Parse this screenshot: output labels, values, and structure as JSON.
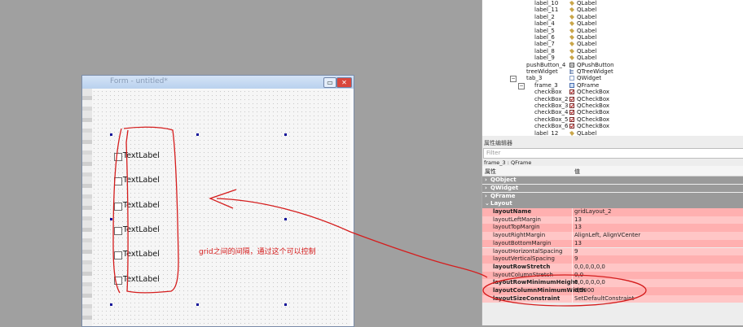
{
  "canvas": {
    "window_title": "Form - untitled*",
    "checkbox_labels": [
      "TextLabel",
      "TextLabel",
      "TextLabel",
      "TextLabel",
      "TextLabel",
      "TextLabel"
    ],
    "annotation": "grid之间的间隔，通过这个可以控制",
    "annotation_color": "#d51d1d"
  },
  "object_inspector": {
    "rows": [
      {
        "name": "label_10",
        "cls": "QLabel",
        "icon": "label-icon"
      },
      {
        "name": "label_11",
        "cls": "QLabel",
        "icon": "label-icon"
      },
      {
        "name": "label_2",
        "cls": "QLabel",
        "icon": "label-icon"
      },
      {
        "name": "label_4",
        "cls": "QLabel",
        "icon": "label-icon"
      },
      {
        "name": "label_5",
        "cls": "QLabel",
        "icon": "label-icon"
      },
      {
        "name": "label_6",
        "cls": "QLabel",
        "icon": "label-icon"
      },
      {
        "name": "label_7",
        "cls": "QLabel",
        "icon": "label-icon"
      },
      {
        "name": "label_8",
        "cls": "QLabel",
        "icon": "label-icon"
      },
      {
        "name": "label_9",
        "cls": "QLabel",
        "icon": "label-icon"
      },
      {
        "name": "pushButton_4",
        "cls": "QPushButton",
        "icon": "pushbutton-icon"
      },
      {
        "name": "treeWidget",
        "cls": "QTreeWidget",
        "icon": "treewidget-icon"
      },
      {
        "name": "tab_3",
        "cls": "QWidget",
        "icon": "widget-icon",
        "toggle": "−"
      },
      {
        "name": "frame_3",
        "cls": "QFrame",
        "icon": "frame-icon",
        "toggle": "−"
      },
      {
        "name": "checkBox",
        "cls": "QCheckBox",
        "icon": "checkbox-icon"
      },
      {
        "name": "checkBox_2",
        "cls": "QCheckBox",
        "icon": "checkbox-icon"
      },
      {
        "name": "checkBox_3",
        "cls": "QCheckBox",
        "icon": "checkbox-icon"
      },
      {
        "name": "checkBox_4",
        "cls": "QCheckBox",
        "icon": "checkbox-icon"
      },
      {
        "name": "checkBox_5",
        "cls": "QCheckBox",
        "icon": "checkbox-icon"
      },
      {
        "name": "checkBox_6",
        "cls": "QCheckBox",
        "icon": "checkbox-icon"
      },
      {
        "name": "label_12",
        "cls": "QLabel",
        "icon": "label-icon"
      }
    ]
  },
  "property_editor": {
    "title": "属性编辑器",
    "filter_placeholder": "Filter",
    "object_line": "frame_3 : QFrame",
    "col_property": "属性",
    "col_value": "值",
    "groups": [
      {
        "label": "QObject",
        "arrow": "›"
      },
      {
        "label": "QWidget",
        "arrow": "›"
      },
      {
        "label": "QFrame",
        "arrow": "›"
      },
      {
        "label": "Layout",
        "arrow": "⌄"
      }
    ],
    "layout_props": [
      {
        "name": "layoutName",
        "value": "gridLayout_2",
        "bold": true
      },
      {
        "name": "layoutLeftMargin",
        "value": "13",
        "bold": false
      },
      {
        "name": "layoutTopMargin",
        "value": "13",
        "bold": false
      },
      {
        "name": "layoutRightMargin",
        "value": "AlignLeft, AlignVCenter",
        "bold": false
      },
      {
        "name": "layoutBottomMargin",
        "value": "13",
        "bold": false
      },
      {
        "name": "layoutHorizontalSpacing",
        "value": "9",
        "bold": false
      },
      {
        "name": "layoutVerticalSpacing",
        "value": "9",
        "bold": false
      },
      {
        "name": "layoutRowStretch",
        "value": "0,0,0,0,0,0",
        "bold": true
      },
      {
        "name": "layoutColumnStretch",
        "value": "0,0",
        "bold": false
      },
      {
        "name": "layoutRowMinimumHeight",
        "value": "0,0,0,0,0,0",
        "bold": true
      },
      {
        "name": "layoutColumnMinimumWidth",
        "value": "0,1000",
        "bold": true
      },
      {
        "name": "layoutSizeConstraint",
        "value": "SetDefaultConstraint",
        "bold": true
      }
    ]
  },
  "colors": {
    "group_bg": "#9a9a9a",
    "layout_row_a": "#ffc6c6",
    "layout_row_b": "#ffb0b0",
    "selection_handles": "#14149a"
  }
}
